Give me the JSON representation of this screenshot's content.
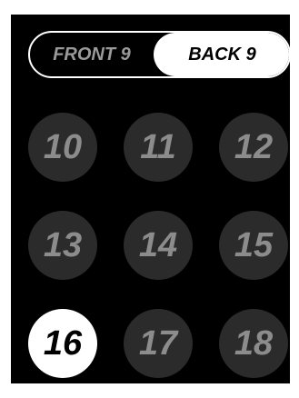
{
  "nine_toggle": {
    "front_label": "FRONT 9",
    "back_label": "BACK 9",
    "selected": "back"
  },
  "holes": [
    {
      "label": "10",
      "selected": false
    },
    {
      "label": "11",
      "selected": false
    },
    {
      "label": "12",
      "selected": false
    },
    {
      "label": "13",
      "selected": false
    },
    {
      "label": "14",
      "selected": false
    },
    {
      "label": "15",
      "selected": false
    },
    {
      "label": "16",
      "selected": true
    },
    {
      "label": "17",
      "selected": false
    },
    {
      "label": "18",
      "selected": false
    }
  ],
  "colors": {
    "background": "#000000",
    "hole_default": "#2b2b2b",
    "hole_text": "#8c8c8c",
    "selected": "#ffffff"
  }
}
